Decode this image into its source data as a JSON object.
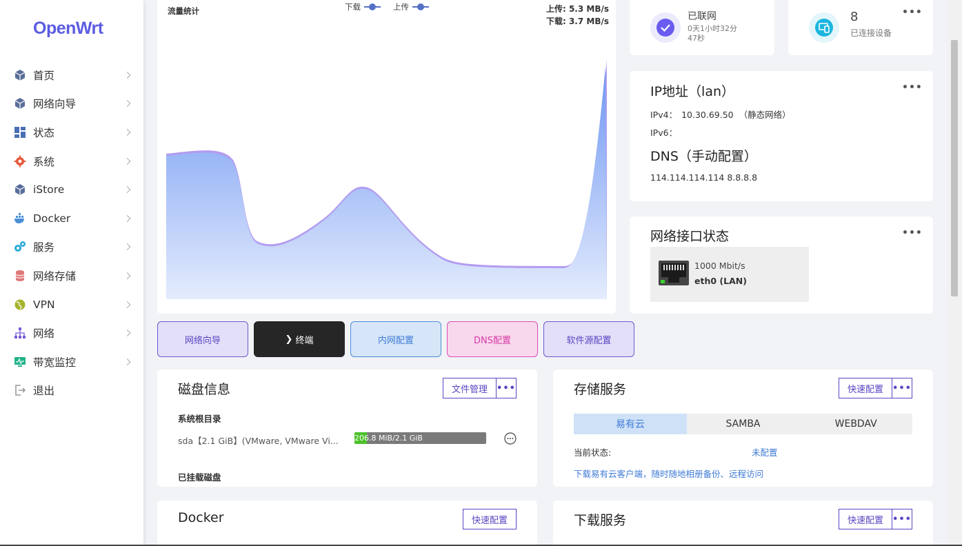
{
  "sidebar": {
    "logo": "OpenWrt",
    "items": [
      {
        "label": "首页",
        "icon": "cube-icon"
      },
      {
        "label": "网络向导",
        "icon": "cube-icon"
      },
      {
        "label": "状态",
        "icon": "grid-icon"
      },
      {
        "label": "系统",
        "icon": "gear-icon"
      },
      {
        "label": "iStore",
        "icon": "cube-icon"
      },
      {
        "label": "Docker",
        "icon": "docker-icon"
      },
      {
        "label": "服务",
        "icon": "gears-icon"
      },
      {
        "label": "网络存储",
        "icon": "database-icon"
      },
      {
        "label": "VPN",
        "icon": "globe-icon"
      },
      {
        "label": "网络",
        "icon": "sitemap-icon"
      },
      {
        "label": "带宽监控",
        "icon": "monitor-icon"
      },
      {
        "label": "退出",
        "icon": "logout-icon"
      }
    ]
  },
  "traffic": {
    "title": "流量统计",
    "legend_down": "下载",
    "legend_up": "上传",
    "upload_rate": "上传: 5.3 MB/s",
    "download_rate": "下载: 3.7 MB/s"
  },
  "network_status": {
    "title": "已联网",
    "uptime_line1": "0天1小时32分",
    "uptime_line2": "47秒"
  },
  "devices": {
    "count": "8",
    "label": "已连接设备"
  },
  "ip": {
    "title": "IP地址（lan）",
    "ipv4_label": "IPv4：",
    "ipv4_value": "10.30.69.50",
    "ipv4_note": "（静态网络）",
    "ipv6_label": "IPv6：",
    "dns_title": "DNS（手动配置）",
    "dns_value": "114.114.114.114 8.8.8.8"
  },
  "interfaces": {
    "title": "网络接口状态",
    "speed": "1000 Mbit/s",
    "name": "eth0 (LAN)"
  },
  "quick_buttons": [
    "网络向导",
    "终端",
    "内网配置",
    "DNS配置",
    "软件源配置"
  ],
  "disk": {
    "title": "磁盘信息",
    "file_manage": "文件管理",
    "root_label": "系统根目录",
    "device": "sda【2.1 GiB】(VMware, VMware Vi...",
    "usage_text": "206.8 MiB/2.1 GiB",
    "usage_fraction": 0.096,
    "mounted_label": "已挂载磁盘"
  },
  "storage": {
    "title": "存储服务",
    "quick_config": "快速配置",
    "tabs": [
      "易有云",
      "SAMBA",
      "WEBDAV"
    ],
    "status_label": "当前状态:",
    "status_value": "未配置",
    "link": "下载易有云客户端，随时随地相册备份、远程访问"
  },
  "docker": {
    "title": "Docker",
    "quick_config": "快速配置"
  },
  "download": {
    "title": "下载服务",
    "quick_config": "快速配置"
  },
  "more_label": "•••",
  "colors": {
    "accent": "#5b5ce2",
    "online": "#6a5cf0",
    "device": "#1cb5e0"
  }
}
